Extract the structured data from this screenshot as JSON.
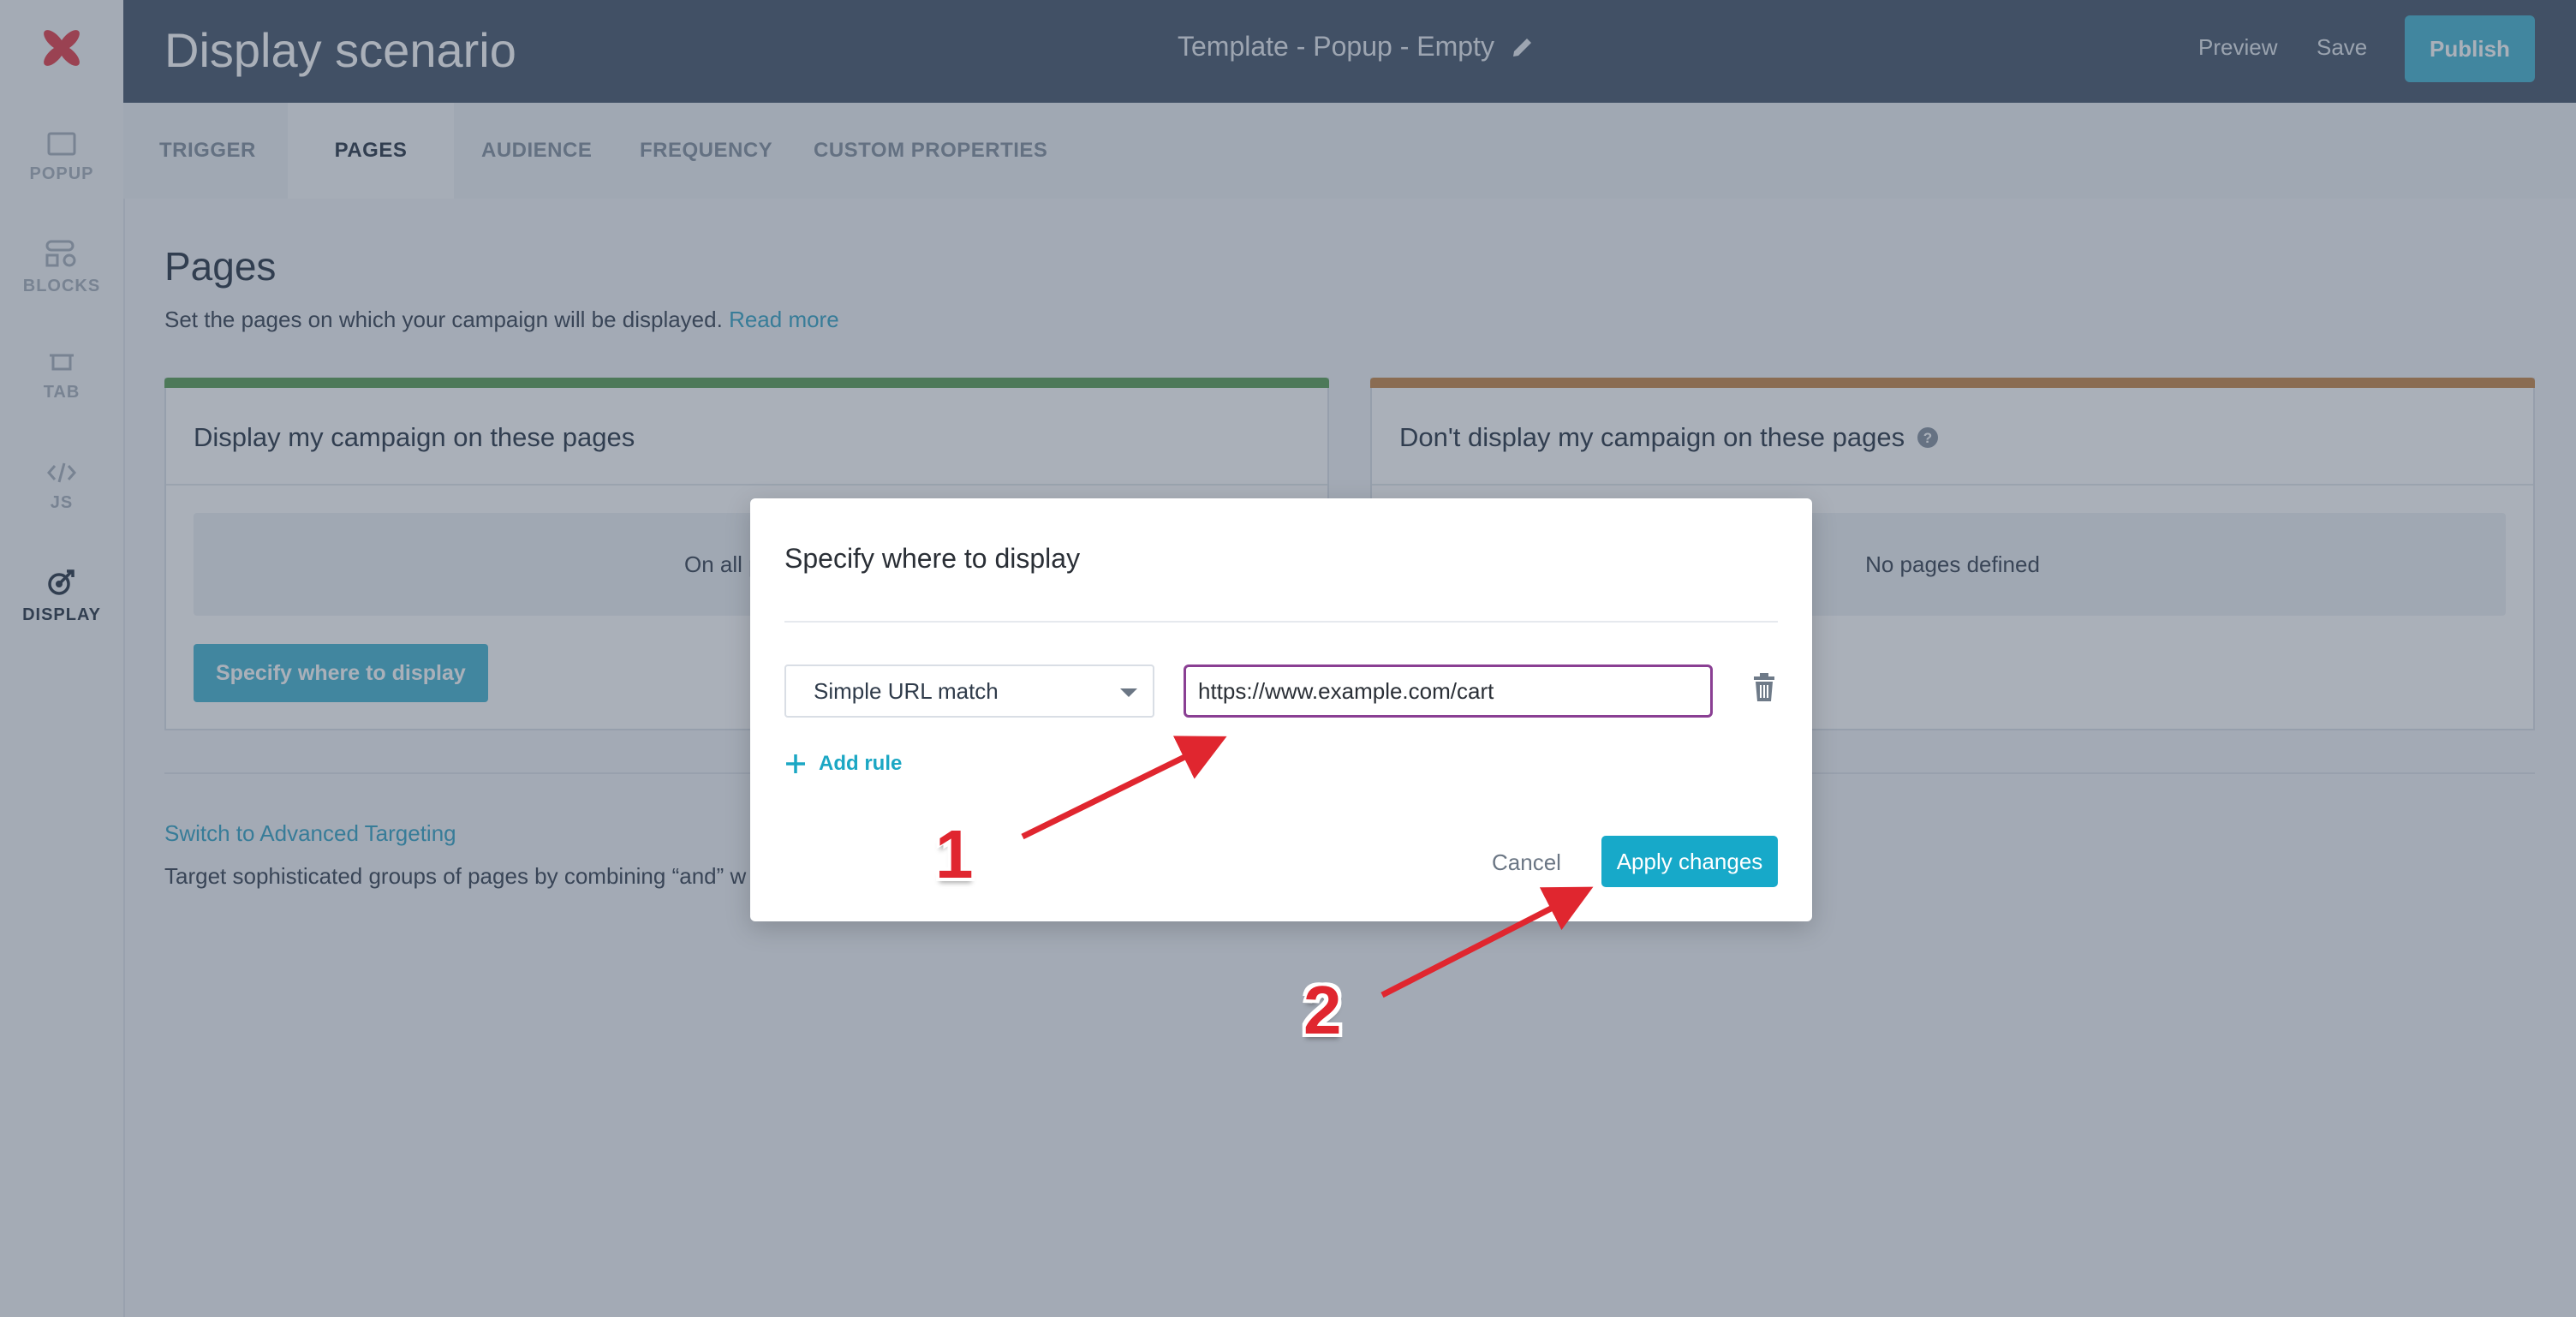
{
  "app": {
    "title": "Display scenario",
    "template_name": "Template - Popup - Empty",
    "preview_label": "Preview",
    "save_label": "Save",
    "publish_label": "Publish",
    "accent_color": "#4bb7d3",
    "header_color": "#4b5b6f"
  },
  "sidebar": {
    "items": [
      {
        "label": "POPUP",
        "icon": "popup-icon"
      },
      {
        "label": "BLOCKS",
        "icon": "blocks-icon"
      },
      {
        "label": "TAB",
        "icon": "tab-icon"
      },
      {
        "label": "JS",
        "icon": "code-icon"
      },
      {
        "label": "DISPLAY",
        "icon": "target-icon",
        "active": true
      }
    ]
  },
  "tabs": [
    {
      "label": "TRIGGER"
    },
    {
      "label": "PAGES",
      "active": true
    },
    {
      "label": "AUDIENCE"
    },
    {
      "label": "FREQUENCY"
    },
    {
      "label": "CUSTOM PROPERTIES"
    }
  ],
  "page": {
    "title": "Pages",
    "description": "Set the pages on which your campaign will be displayed.",
    "read_more": "Read more"
  },
  "include_card": {
    "title": "Display my campaign on these pages",
    "empty_text": "On all pages",
    "button_label": "Specify where to display",
    "bar_color": "#5fa05a"
  },
  "exclude_card": {
    "title": "Don't display my campaign on these pages",
    "empty_text": "No pages defined",
    "bar_color": "#c98a4f"
  },
  "advanced": {
    "link": "Switch to Advanced Targeting",
    "description": "Target sophisticated groups of pages by combining “and” w"
  },
  "modal": {
    "title": "Specify where to display",
    "rule_type": "Simple URL match",
    "url_value": "https://www.example.com/cart",
    "add_rule": "Add rule",
    "cancel_label": "Cancel",
    "apply_label": "Apply changes"
  },
  "annotations": {
    "step1": "1",
    "step2": "2",
    "arrow_color": "#e0262f"
  }
}
